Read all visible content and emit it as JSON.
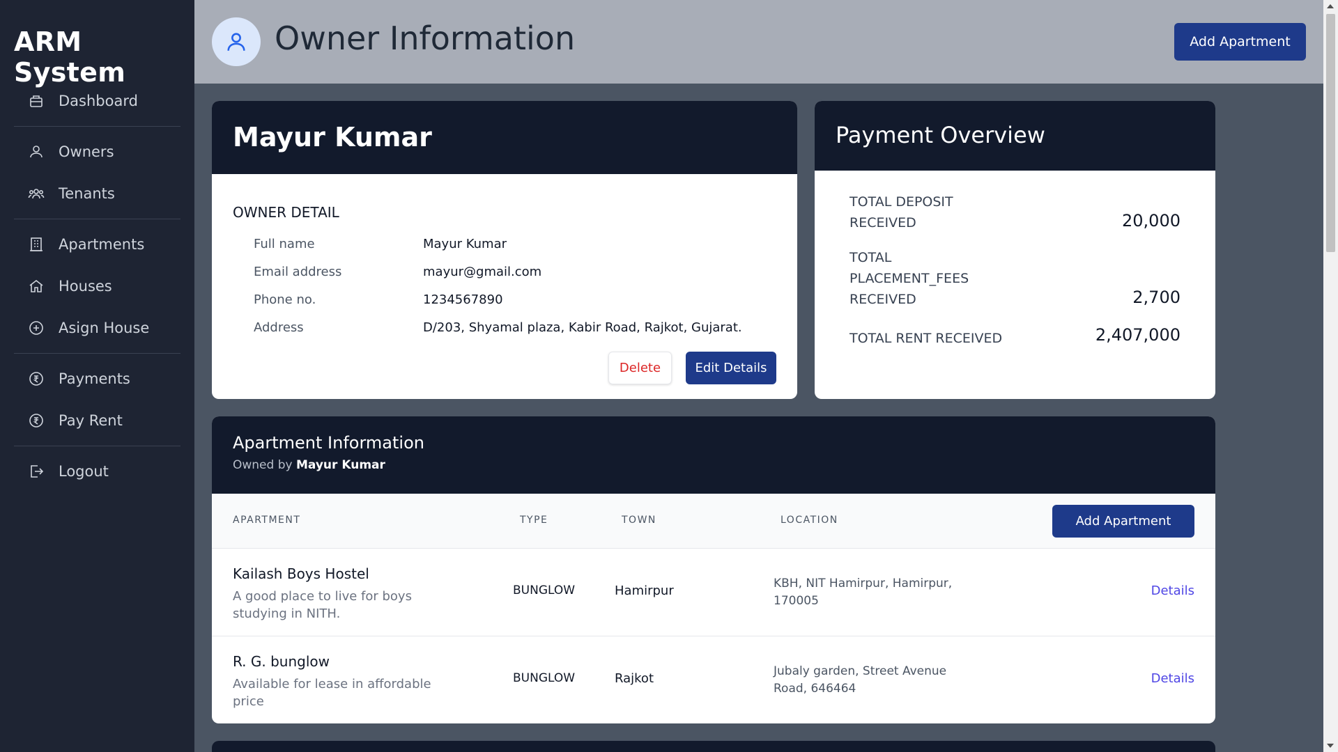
{
  "app": {
    "title": "ARM System"
  },
  "sidebar": {
    "items": [
      {
        "label": "Dashboard",
        "icon": "briefcase-icon"
      },
      {
        "label": "Owners",
        "icon": "users-icon"
      },
      {
        "label": "Tenants",
        "icon": "user-group-icon"
      },
      {
        "label": "Apartments",
        "icon": "building-icon"
      },
      {
        "label": "Houses",
        "icon": "home-icon"
      },
      {
        "label": "Asign House",
        "icon": "plus-circle-icon"
      },
      {
        "label": "Payments",
        "icon": "rupee-circle-icon"
      },
      {
        "label": "Pay Rent",
        "icon": "rupee-circle-icon"
      },
      {
        "label": "Logout",
        "icon": "logout-icon"
      }
    ]
  },
  "header": {
    "title": "Owner Information",
    "add_button": "Add Apartment"
  },
  "owner": {
    "name": "Mayur Kumar",
    "section_label": "OWNER DETAIL",
    "fields": [
      {
        "label": "Full name",
        "value": "Mayur Kumar"
      },
      {
        "label": "Email address",
        "value": "mayur@gmail.com"
      },
      {
        "label": "Phone no.",
        "value": "1234567890"
      },
      {
        "label": "Address",
        "value": "D/203, Shyamal plaza, Kabir Road, Rajkot, Gujarat."
      }
    ],
    "delete_label": "Delete",
    "edit_label": "Edit Details"
  },
  "payment": {
    "title": "Payment Overview",
    "deposit_label_1": "TOTAL DEPOSIT",
    "deposit_label_2": "RECEIVED",
    "deposit_value": "20,000",
    "placement_label_1": "TOTAL",
    "placement_label_2": "PLACEMENT_FEES",
    "placement_label_3": "RECEIVED",
    "placement_value": "2,700",
    "rent_label": "TOTAL RENT RECEIVED",
    "rent_value": "2,407,000"
  },
  "apartments": {
    "title": "Apartment Information",
    "owned_by_prefix": "Owned by",
    "owned_by_name": "Mayur Kumar",
    "columns": [
      "APARTMENT",
      "TYPE",
      "TOWN",
      "LOCATION"
    ],
    "add_button": "Add Apartment",
    "rows": [
      {
        "name": "Kailash Boys Hostel",
        "description": "A good place to live for boys studying in NITH.",
        "type": "BUNGLOW",
        "town": "Hamirpur",
        "location": "KBH, NIT Hamirpur, Hamirpur, 170005",
        "link": "Details"
      },
      {
        "name": "R. G. bunglow",
        "description": "Available for lease in affordable price",
        "type": "BUNGLOW",
        "town": "Rajkot",
        "location": "Jubaly garden, Street Avenue Road, 646464",
        "link": "Details"
      }
    ]
  },
  "colors": {
    "sidebar_bg": "#1e2433",
    "card_header_bg": "#121a2c",
    "primary_button": "#1e3a8a",
    "delete_text": "#dc2626",
    "link": "#4f46e5"
  }
}
